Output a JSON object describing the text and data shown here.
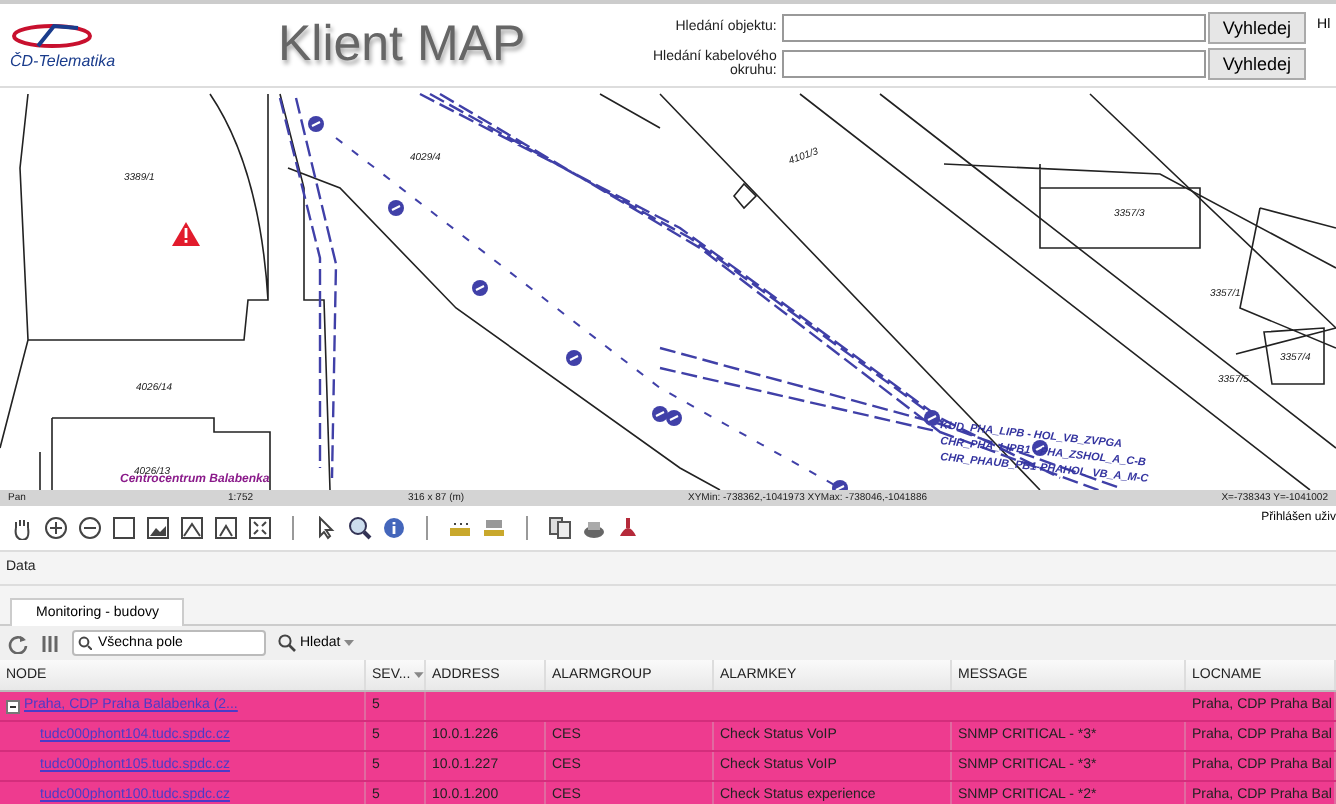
{
  "header": {
    "logo_text": "ČD-Telematika",
    "title": "Klient MAP",
    "searches": [
      {
        "label": "Hledání objektu:",
        "button": "Vyhledej"
      },
      {
        "label": "Hledání kabelového okruhu:",
        "button": "Vyhledej"
      }
    ],
    "cut_label": "Hl"
  },
  "map": {
    "labels": [
      {
        "kind": "parcel",
        "text": "3389/1"
      },
      {
        "kind": "parcel",
        "text": "4029/4"
      },
      {
        "kind": "parcel",
        "text": "4026/14"
      },
      {
        "kind": "parcel",
        "text": "4026/13"
      },
      {
        "kind": "parcel",
        "text": "4101/3"
      },
      {
        "kind": "parcel",
        "text": "3357/3"
      },
      {
        "kind": "parcel",
        "text": "3357/1"
      },
      {
        "kind": "parcel",
        "text": "3357/5"
      },
      {
        "kind": "parcel",
        "text": "3357/4"
      },
      {
        "kind": "place",
        "text": "Centrocentrum Balabenka"
      },
      {
        "kind": "cable",
        "text": "KUD_PHA_LIPB - HOL_VB_ZVPGA"
      },
      {
        "kind": "cable",
        "text": "CHR_PHA_LIPB1 - PHA_ZSHOL_A_C-B"
      },
      {
        "kind": "cable",
        "text": "CHR_PHAUB_PB1-PHAHOL_VB_A_M-C"
      }
    ]
  },
  "status_bar": {
    "tool": "Pan",
    "scale": "1:752",
    "size": "316 x 87 (m)",
    "extent": "XYMin: -738362,-1041973  XYMax: -738046,-1041886",
    "cursor": "X=-738343 Y=-1041002"
  },
  "user": "Přihlášen uživ",
  "data_panel": {
    "title": "Data",
    "tabs": [
      {
        "label": "Monitoring - budovy",
        "selected": true
      }
    ],
    "search": {
      "value": "Všechna pole"
    },
    "search_button": "Hledat",
    "table": {
      "columns": [
        "NODE",
        "SEV...",
        "ADDRESS",
        "ALARMGROUP",
        "ALARMKEY",
        "MESSAGE",
        "LOCNAME"
      ],
      "rows": [
        {
          "kind": "group",
          "expanded": true,
          "cells": [
            "Praha, CDP Praha Balabenka (2...",
            "5",
            "",
            "",
            "",
            "",
            "Praha, CDP Praha Bal"
          ]
        },
        {
          "kind": "item",
          "cells": [
            "tudc000phont104.tudc.spdc.cz",
            "5",
            "10.0.1.226",
            "CES",
            "Check Status VoIP",
            "SNMP CRITICAL - *3*",
            "Praha, CDP Praha Bal"
          ]
        },
        {
          "kind": "item",
          "cells": [
            "tudc000phont105.tudc.spdc.cz",
            "5",
            "10.0.1.227",
            "CES",
            "Check Status VoIP",
            "SNMP CRITICAL - *3*",
            "Praha, CDP Praha Bal"
          ]
        },
        {
          "kind": "item",
          "cells": [
            "tudc000phont100.tudc.spdc.cz",
            "5",
            "10.0.1.200",
            "CES",
            "Check Status experience",
            "SNMP CRITICAL - *2*",
            "Praha, CDP Praha Bal"
          ]
        }
      ]
    }
  }
}
